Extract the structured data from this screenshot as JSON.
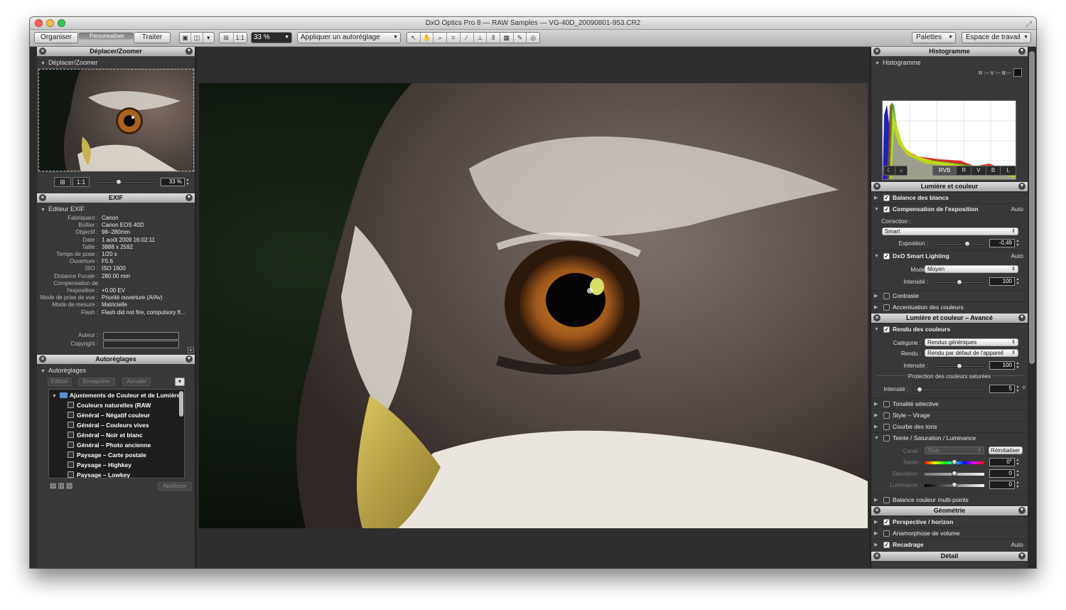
{
  "window": {
    "title": "DxO Optics Pro 8 — RAW Samples — VG-40D_20090801-953.CR2",
    "fullscreen_icon": "fullscreen-arrows-icon"
  },
  "toolbar": {
    "tabs": [
      "Organiser",
      "Personnaliser",
      "Traiter"
    ],
    "active_tab": "Personnaliser",
    "zoom_value": "33 %",
    "one_to_one": "1:1",
    "preset_select": "Appliquer un autoréglage",
    "palettes": "Palettes",
    "workspace": "Espace de travail",
    "tool_icons": [
      "pointer-icon",
      "hand-icon",
      "zoom-icon",
      "crop-icon",
      "eyedropper-icon",
      "horizon-icon",
      "perspective-icon",
      "grid-icon",
      "repair-icon",
      "red-eye-icon"
    ]
  },
  "left": {
    "move_zoom": {
      "header": "Déplacer/Zoomer",
      "sub": "Déplacer/Zoomer",
      "one_to_one": "1:1",
      "zoom": "33 %",
      "zoom_level": 0.33
    },
    "exif": {
      "header": "EXIF",
      "sub": "Editeur EXIF",
      "rows": [
        {
          "k": "Fabriquant :",
          "v": "Canon"
        },
        {
          "k": "Boîtier :",
          "v": "Canon EOS 40D"
        },
        {
          "k": "Objectif :",
          "v": "98–280mm"
        },
        {
          "k": "Date :",
          "v": "1 août 2009 16:02:11"
        },
        {
          "k": "Taille :",
          "v": "3888 x 2592"
        },
        {
          "k": "Temps de pose :",
          "v": "1/20 s"
        },
        {
          "k": "Ouverture :",
          "v": "F5.6"
        },
        {
          "k": "ISO :",
          "v": "ISO 1600"
        },
        {
          "k": "Distance Focale :",
          "v": "280.00 mm"
        },
        {
          "k": "Compensation de",
          "v": ""
        },
        {
          "k": "l'exposition :",
          "v": "+0.00 EV"
        },
        {
          "k": "Mode de prise de vue :",
          "v": "Priorité ouverture (A/Av)"
        },
        {
          "k": "Mode de mesure :",
          "v": "Matricielle"
        },
        {
          "k": "Flash :",
          "v": "Flash did not fire, compulsory fl..."
        }
      ],
      "author_label": "Auteur :",
      "copyright_label": "Copyright :"
    },
    "presets": {
      "header": "Autoréglages",
      "sub": "Autoréglages",
      "btn_edit": "Edition",
      "btn_save": "Enregistrer",
      "btn_cancel": "Annuler",
      "folder": "Ajustements de Couleur et de Lumière",
      "items": [
        "Couleurs naturelles (RAW",
        "Général – Négatif couleur",
        "Général – Couleurs vives",
        "Général – Noir et blanc",
        "Général – Photo ancienne",
        "Paysage – Carte postale",
        "Paysage – Highkey",
        "Paysage – Lowkey"
      ],
      "apply": "Appliquer"
    }
  },
  "right": {
    "histogram": {
      "header": "Histogramme",
      "sub": "Histogramme",
      "readout": "R :-- V :-- B:--",
      "channels": [
        "RVB",
        "R",
        "V",
        "B",
        "L"
      ],
      "active_channel": "RVB"
    },
    "light_color": {
      "header": "Lumière et couleur",
      "white_balance": "Balance des blancs",
      "exposure_comp": "Compensation de l'exposition",
      "auto": "Auto",
      "correction_label": "Correction :",
      "correction_value": "Smart",
      "exposure_label": "Exposition :",
      "exposure_value": "-0,49",
      "exposure_level": 0.49,
      "smart_lighting": "DxO Smart Lighting",
      "mode_label": "Mode :",
      "mode_value": "Moyen",
      "intensity_label": "Intensité :",
      "intensity_value": "100",
      "intensity_level": 0.5,
      "contrast": "Contraste",
      "color_accent": "Accentuation des couleurs"
    },
    "advanced": {
      "header": "Lumière et couleur – Avancé",
      "color_rendering": "Rendu des couleurs",
      "category_label": "Catégorie :",
      "category_value": "Rendus génériques",
      "render_label": "Rendu :",
      "render_value": "Rendu par défaut de l'appareil",
      "intensity_label": "Intensité :",
      "intensity_value": "100",
      "intensity_level": 0.5,
      "protect_title": "Protection des couleurs saturées",
      "protect_intensity_label": "Intensité :",
      "protect_intensity_value": "5",
      "protect_level": 0.05,
      "selective_tone": "Tonalité sélective",
      "style_toning": "Style – Virage",
      "tone_curve": "Courbe des tons",
      "hsl": "Teinte / Saturation / Luminance",
      "channel_label": "Canal :",
      "channel_value": "Tous",
      "reset": "Réinitialiser",
      "hue_label": "Teinte :",
      "hue_value": "0°",
      "saturation_label": "Saturation :",
      "saturation_value": "0",
      "luminance_label": "Luminance :",
      "luminance_value": "0",
      "multipoint": "Balance couleur multi-points"
    },
    "geometry": {
      "header": "Géométrie",
      "perspective": "Perspective / horizon",
      "volume": "Anamorphose de volume",
      "crop": "Recadrage",
      "auto": "Auto"
    },
    "detail": {
      "header": "Détail"
    }
  },
  "colors": {
    "accent_blue": "#5b8fd4",
    "panel": "#383838",
    "window": "#2c2c2c"
  }
}
